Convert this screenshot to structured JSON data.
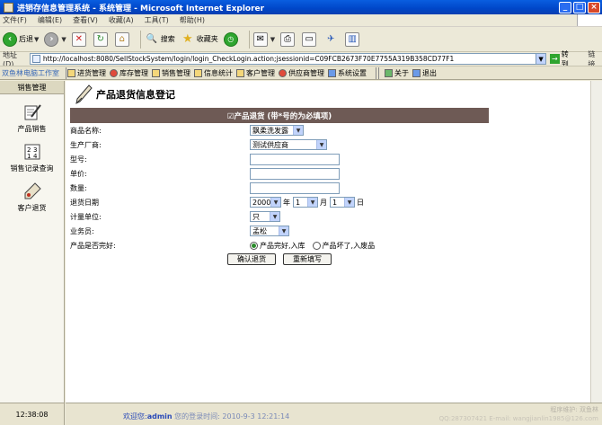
{
  "window": {
    "title": "进销存信息管理系统 - 系统管理 - Microsoft Internet Explorer",
    "min": "_",
    "max": "□",
    "close": "×"
  },
  "menu": [
    "文件(F)",
    "编辑(E)",
    "查看(V)",
    "收藏(A)",
    "工具(T)",
    "帮助(H)"
  ],
  "toolbar": {
    "back": "后退",
    "search": "搜索",
    "favorites": "收藏夹"
  },
  "address": {
    "label": "地址(D)",
    "url": "http://localhost:8080/SellStockSystem/login/login_CheckLogin.action;jsessionid=C09FCB2673F70E7755A319B358CD77F1",
    "go": "转到",
    "links": "链接"
  },
  "appnav": {
    "brand": "双鱼林电脑工作室",
    "items": [
      "进货管理",
      "库存管理",
      "销售管理",
      "信息统计",
      "客户管理",
      "供应商管理",
      "系统设置",
      "关于",
      "退出"
    ]
  },
  "sidebar": {
    "title": "销售管理",
    "items": [
      "产品销售",
      "销售记录查询",
      "客户退货"
    ]
  },
  "page": {
    "title": "产品退货信息登记",
    "form_header": "☑产品退货 (带*号的为必填项)"
  },
  "form": {
    "product_label": "商品名称:",
    "product_value": "飘柔洗发露",
    "maker_label": "生产厂商:",
    "maker_value": "测试供应商",
    "model_label": "型号:",
    "model_value": "",
    "price_label": "单价:",
    "price_value": "",
    "qty_label": "数量:",
    "qty_value": "",
    "date_label": "退货日期",
    "year": "2000",
    "year_unit": "年",
    "month": "1",
    "month_unit": "月",
    "day": "1",
    "day_unit": "日",
    "unit_label": "计量单位:",
    "unit_value": "只",
    "clerk_label": "业务员:",
    "clerk_value": "孟松",
    "condition_label": "产品是否完好:",
    "condition_ok": "产品完好,入库",
    "condition_bad": "产品坏了,入废品",
    "submit": "确认退货",
    "reset": "重新填写"
  },
  "footer": {
    "clock": "12:38:08",
    "welcome": "欢迎您:",
    "user": "admin",
    "login_time": "您的登录时间: 2010-9-3 12:21:14",
    "watermark1": "程序维护: 双鱼林",
    "watermark2": "QQ:287307421 E-mail: wangjianlin1985@126.com"
  }
}
